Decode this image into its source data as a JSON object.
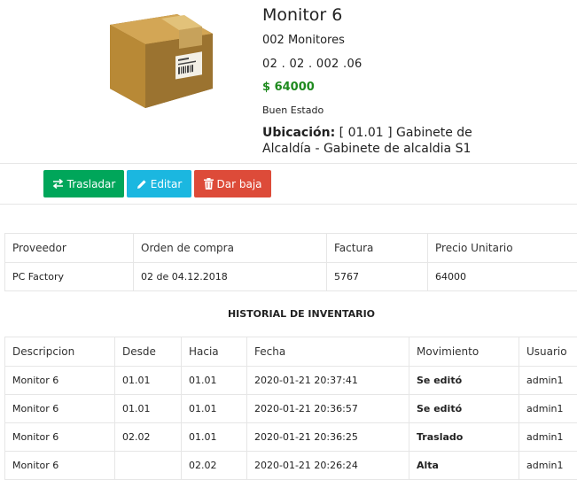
{
  "product": {
    "image_icon": "cardboard-box-icon",
    "name": "Monitor 6",
    "category": "002 Monitores",
    "code": "02 . 02 . 002 .06",
    "price": "$ 64000",
    "state": "Buen Estado",
    "location_label": "Ubicación:",
    "location_value": "[ 01.01 ] Gabinete de Alcaldía - Gabinete de alcaldia S1"
  },
  "actions": {
    "transfer": "Trasladar",
    "edit": "Editar",
    "remove": "Dar baja"
  },
  "colors": {
    "price": "#1e8a1e",
    "transfer_button": "#00a65a",
    "edit_button": "#1bb7e0",
    "remove_button": "#dd4b39",
    "movement_edit": "#222222",
    "movement_transfer": "#1e8a1e",
    "movement_alta": "#1a1ad0"
  },
  "purchase_table": {
    "headers": [
      "Proveedor",
      "Orden de compra",
      "Factura",
      "Precio Unitario"
    ],
    "row": [
      "PC Factory",
      "02 de 04.12.2018",
      "5767",
      "64000"
    ]
  },
  "history": {
    "title": "HISTORIAL DE INVENTARIO",
    "headers": [
      "Descripcion",
      "Desde",
      "Hacia",
      "Fecha",
      "Movimiento",
      "Usuario"
    ],
    "rows": [
      [
        "Monitor 6",
        "01.01",
        "01.01",
        "2020-01-21 20:37:41",
        "Se editó",
        "admin1"
      ],
      [
        "Monitor 6",
        "01.01",
        "01.01",
        "2020-01-21 20:36:57",
        "Se editó",
        "admin1"
      ],
      [
        "Monitor 6",
        "02.02",
        "01.01",
        "2020-01-21 20:36:25",
        "Traslado",
        "admin1"
      ],
      [
        "Monitor 6",
        "",
        "02.02",
        "2020-01-21 20:26:24",
        "Alta",
        "admin1"
      ]
    ]
  }
}
